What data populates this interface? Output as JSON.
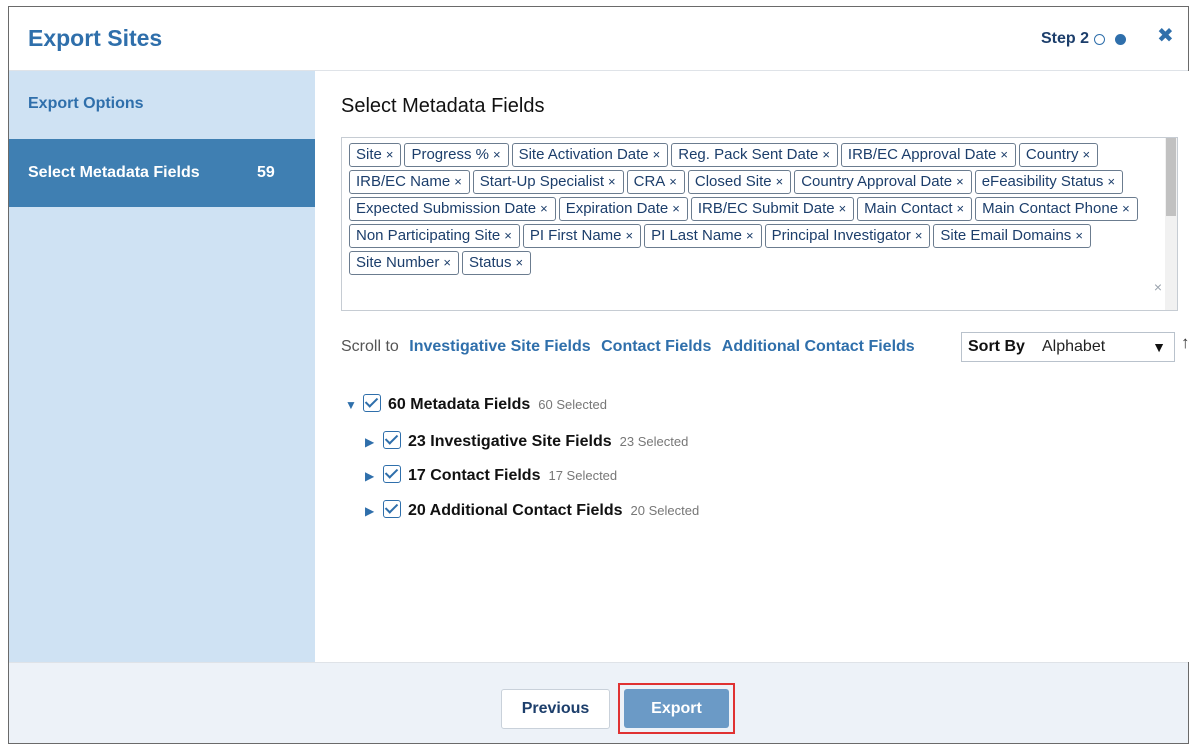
{
  "header": {
    "title": "Export Sites",
    "step_label": "Step 2",
    "close_glyph": "✖"
  },
  "sidebar": {
    "items": [
      {
        "label": "Export Options"
      },
      {
        "label": "Select Metadata Fields",
        "count": "59"
      }
    ]
  },
  "main": {
    "title": "Select Metadata Fields",
    "tag_remove_glyph": "×",
    "clear_glyph": "×",
    "tags": [
      "Site",
      "Progress %",
      "Site Activation Date",
      "Reg. Pack Sent Date",
      "IRB/EC Approval Date",
      "Country",
      "IRB/EC Name",
      "Start-Up Specialist",
      "CRA",
      "Closed Site",
      "Country Approval Date",
      "eFeasibility Status",
      "Expected Submission Date",
      "Expiration Date",
      "IRB/EC Submit Date",
      "Main Contact",
      "Main Contact Phone",
      "Non Participating Site",
      "PI First Name",
      "PI Last Name",
      "Principal Investigator",
      "Site Email Domains",
      "Site Number",
      "Status"
    ],
    "scroll_to": {
      "label": "Scroll to",
      "links": [
        "Investigative Site Fields",
        "Contact Fields",
        "Additional Contact Fields"
      ]
    },
    "sort": {
      "label": "Sort By",
      "value": "Alphabet",
      "caret": "▼",
      "direction_glyph": "↑"
    },
    "tree": {
      "root": {
        "name": "60 Metadata Fields",
        "selected": "60 Selected",
        "expander": "▼"
      },
      "children": [
        {
          "name": "23 Investigative Site Fields",
          "selected": "23 Selected",
          "expander": "▶"
        },
        {
          "name": "17 Contact Fields",
          "selected": "17 Selected",
          "expander": "▶"
        },
        {
          "name": "20 Additional Contact Fields",
          "selected": "20 Selected",
          "expander": "▶"
        }
      ]
    }
  },
  "footer": {
    "previous_label": "Previous",
    "export_label": "Export"
  },
  "colors": {
    "accent": "#2f6fab",
    "sidebar_bg": "#cfe2f3",
    "sidebar_active": "#3f7fb2",
    "export_button": "#6b9ac6",
    "highlight_border": "#e03232"
  }
}
